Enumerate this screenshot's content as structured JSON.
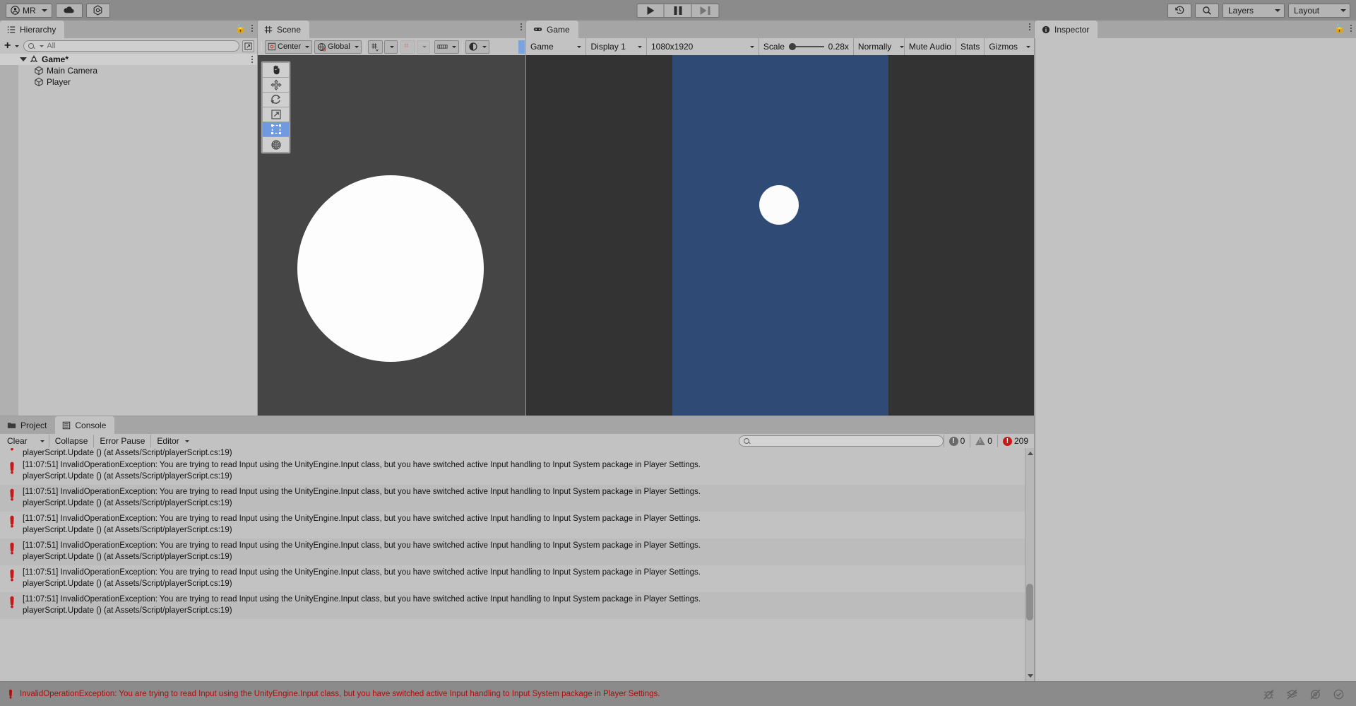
{
  "toolbar": {
    "account_label": "MR",
    "account_icon": "person-icon",
    "cloud_icon": "cloud-icon",
    "packages_icon": "package-manager-icon",
    "play_icon": "play-icon",
    "pause_icon": "pause-icon",
    "step_icon": "step-icon",
    "history_icon": "undo-history-icon",
    "search_icon": "search-icon",
    "layers_label": "Layers",
    "layout_label": "Layout"
  },
  "hierarchy": {
    "tab_label": "Hierarchy",
    "tab_icon": "hierarchy-icon",
    "lock_icon": "lock-open-icon",
    "menu_icon": "kebab-menu-icon",
    "add_label": "+",
    "search_placeholder": "All",
    "search_icon": "search-icon",
    "expand_icon": "expand-search-icon",
    "items": [
      {
        "label": "Game*",
        "icon": "scene-icon",
        "depth": 0,
        "expanded": true,
        "selected": false
      },
      {
        "label": "Main Camera",
        "icon": "gameobject-icon",
        "depth": 1,
        "expanded": false,
        "selected": false
      },
      {
        "label": "Player",
        "icon": "gameobject-icon",
        "depth": 1,
        "expanded": false,
        "selected": false
      }
    ]
  },
  "scene": {
    "tab_label": "Scene",
    "tab_icon": "scene-grid-icon",
    "menu_icon": "kebab-menu-icon",
    "pivot_label": "Center",
    "pivot_icon": "pivot-center-icon",
    "space_label": "Global",
    "space_icon": "globe-icon",
    "grid_icon": "grid-snap-icon",
    "snap_icon": "snap-increment-icon",
    "ruler_icon": "ruler-icon",
    "lighting_icon": "scene-lighting-icon",
    "tools": [
      {
        "name": "hand-tool-icon",
        "selected": false
      },
      {
        "name": "move-tool-icon",
        "selected": false
      },
      {
        "name": "rotate-tool-icon",
        "selected": false
      },
      {
        "name": "scale-tool-icon",
        "selected": false
      },
      {
        "name": "rect-tool-icon",
        "selected": true
      },
      {
        "name": "transform-tool-icon",
        "selected": false
      }
    ],
    "background_color": "#454545",
    "shape_color": "#fdfdfd"
  },
  "game": {
    "tab_label": "Game",
    "tab_icon": "gamepad-icon",
    "menu_icon": "kebab-menu-icon",
    "view_label": "Game",
    "display_label": "Display 1",
    "resolution_label": "1080x1920",
    "scale_label": "Scale",
    "scale_value": "0.28x",
    "audio_mode_label": "Normally",
    "mute_label": "Mute Audio",
    "stats_label": "Stats",
    "gizmos_label": "Gizmos",
    "letterbox_color": "#333333",
    "canvas_color": "#2f4a75",
    "ball_color": "#fcfcfc"
  },
  "inspector": {
    "tab_label": "Inspector",
    "tab_icon": "info-icon",
    "lock_icon": "lock-open-icon",
    "menu_icon": "kebab-menu-icon"
  },
  "console": {
    "project_tab_label": "Project",
    "project_tab_icon": "folder-icon",
    "console_tab_label": "Console",
    "console_tab_icon": "console-icon",
    "clear_label": "Clear",
    "collapse_label": "Collapse",
    "error_pause_label": "Error Pause",
    "editor_label": "Editor",
    "search_placeholder": "",
    "search_icon": "search-icon",
    "info_count": "0",
    "warning_count": "0",
    "error_count": "209",
    "info_icon": "info-badge-icon",
    "warning_icon": "warning-badge-icon",
    "error_icon": "error-badge-icon",
    "entries": [
      {
        "icon": "error-icon",
        "line1": "",
        "line2": "playerScript.Update () (at Assets/Script/playerScript.cs:19)",
        "clipped": true
      },
      {
        "icon": "error-icon",
        "line1": "[11:07:51] InvalidOperationException: You are trying to read Input using the UnityEngine.Input class, but you have switched active Input handling to Input System package in Player Settings.",
        "line2": "playerScript.Update () (at Assets/Script/playerScript.cs:19)",
        "clipped": false
      },
      {
        "icon": "error-icon",
        "line1": "[11:07:51] InvalidOperationException: You are trying to read Input using the UnityEngine.Input class, but you have switched active Input handling to Input System package in Player Settings.",
        "line2": "playerScript.Update () (at Assets/Script/playerScript.cs:19)",
        "clipped": false
      },
      {
        "icon": "error-icon",
        "line1": "[11:07:51] InvalidOperationException: You are trying to read Input using the UnityEngine.Input class, but you have switched active Input handling to Input System package in Player Settings.",
        "line2": "playerScript.Update () (at Assets/Script/playerScript.cs:19)",
        "clipped": false
      },
      {
        "icon": "error-icon",
        "line1": "[11:07:51] InvalidOperationException: You are trying to read Input using the UnityEngine.Input class, but you have switched active Input handling to Input System package in Player Settings.",
        "line2": "playerScript.Update () (at Assets/Script/playerScript.cs:19)",
        "clipped": false
      },
      {
        "icon": "error-icon",
        "line1": "[11:07:51] InvalidOperationException: You are trying to read Input using the UnityEngine.Input class, but you have switched active Input handling to Input System package in Player Settings.",
        "line2": "playerScript.Update () (at Assets/Script/playerScript.cs:19)",
        "clipped": false
      },
      {
        "icon": "error-icon",
        "line1": "[11:07:51] InvalidOperationException: You are trying to read Input using the UnityEngine.Input class, but you have switched active Input handling to Input System package in Player Settings.",
        "line2": "playerScript.Update () (at Assets/Script/playerScript.cs:19)",
        "clipped": false
      }
    ]
  },
  "statusbar": {
    "message": "InvalidOperationException: You are trying to read Input using the UnityEngine.Input class, but you have switched active Input handling to Input System package in Player Settings.",
    "error_icon": "error-icon",
    "icons": [
      {
        "name": "bug-off-icon"
      },
      {
        "name": "layers-off-icon"
      },
      {
        "name": "preview-off-icon"
      },
      {
        "name": "check-circle-icon"
      }
    ],
    "error_color": "#b00c0c"
  }
}
